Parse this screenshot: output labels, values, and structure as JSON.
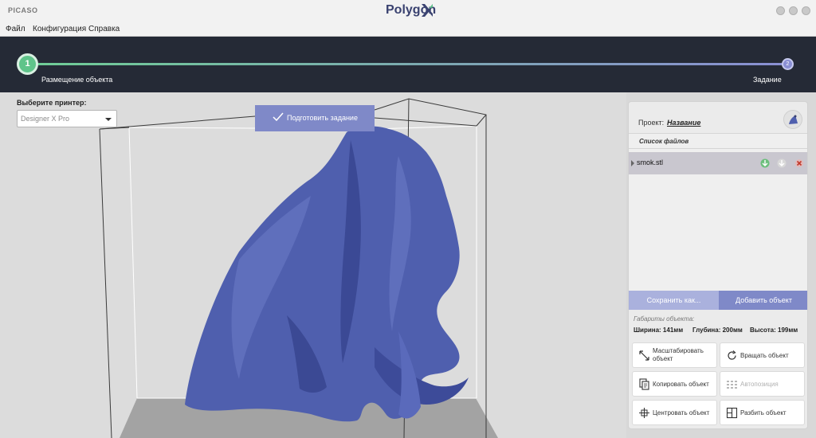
{
  "app": {
    "brand": "PICASO",
    "title": "Polygon"
  },
  "menu": [
    "Файл",
    "Конфигурация",
    "Справка"
  ],
  "stepper": {
    "step1": {
      "number": "1",
      "label": "Размещение объекта"
    },
    "step2": {
      "number": "2",
      "label": "Задание"
    }
  },
  "viewport": {
    "printer_label": "Выберите принтер:",
    "printer_value": "Designer X Pro",
    "prepare_button": "Подготовить задание",
    "model_color": "#4f5fae"
  },
  "panel": {
    "project_label": "Проект:",
    "project_name": "Название",
    "files_header": "Список файлов",
    "files": [
      {
        "name": "smok.stl"
      }
    ],
    "save_button": "Сохранить как...",
    "add_button": "Добавить объект",
    "dims_title": "Габариты объекта:",
    "dims": {
      "width": "Ширина: 141мм",
      "depth": "Глубина: 200мм",
      "height": "Высота: 199мм"
    },
    "tools": {
      "scale": "Масштабировать объект",
      "rotate": "Вращать объект",
      "copy": "Копировать объект",
      "autoposition": "Автопозиция",
      "center": "Центровать объект",
      "split": "Разбить объект"
    }
  },
  "colors": {
    "accent": "#7f89c8",
    "step_done": "#5fc48a",
    "header_bg": "#252a36"
  }
}
